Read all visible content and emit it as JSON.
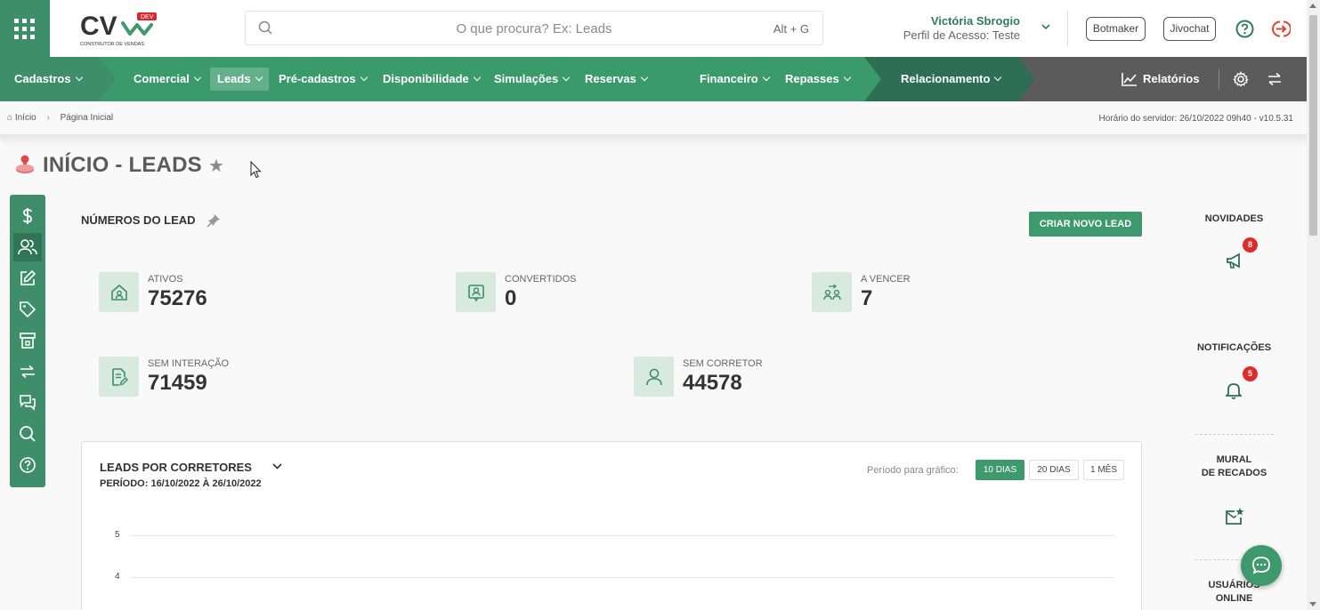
{
  "header": {
    "logo_main": "CV",
    "logo_badge": "DEV",
    "logo_sub": "CONSTRUTOR DE VENDAS",
    "search_placeholder": "O que procura? Ex: Leads",
    "search_shortcut": "Alt + G",
    "user_name": "Victória Sbrogio",
    "user_profile": "Perfil de Acesso: Teste",
    "btn_botmaker": "Botmaker",
    "btn_jivochat": "Jivochat"
  },
  "nav": {
    "items": [
      {
        "label": "Cadastros"
      },
      {
        "label": "Comercial"
      },
      {
        "label": "Leads"
      },
      {
        "label": "Pré-cadastros"
      },
      {
        "label": "Disponibilidade"
      },
      {
        "label": "Simulações"
      },
      {
        "label": "Reservas"
      },
      {
        "label": "Financeiro"
      },
      {
        "label": "Repasses"
      },
      {
        "label": "Relacionamento"
      }
    ],
    "reports": "Relatórios",
    "colors": {
      "primary": "#3e8e6a",
      "dark": "#2e6e55",
      "gray": "#5b5b5b"
    }
  },
  "breadcrumb": {
    "home": "Início",
    "current": "Página Inicial",
    "server_time": "Horário do servidor: 26/10/2022 09h40 - v10.5.31"
  },
  "page": {
    "title": "INÍCIO - LEADS"
  },
  "rail_icons": [
    "dollar-icon",
    "users-icon",
    "edit-icon",
    "tag-icon",
    "building-icon",
    "transfer-icon",
    "chat-icon",
    "search-icon",
    "help-icon"
  ],
  "numbers": {
    "title": "NÚMEROS DO LEAD",
    "new_lead_button": "CRIAR NOVO LEAD",
    "stats": [
      {
        "label": "ATIVOS",
        "value": "75276",
        "icon": "house-user-icon"
      },
      {
        "label": "CONVERTIDOS",
        "value": "0",
        "icon": "user-badge-icon"
      },
      {
        "label": "A VENCER",
        "value": "7",
        "icon": "users-swap-icon"
      },
      {
        "label": "SEM INTERAÇÃO",
        "value": "71459",
        "icon": "document-edit-icon"
      },
      {
        "label": "SEM CORRETOR",
        "value": "44578",
        "icon": "user-icon"
      }
    ]
  },
  "chart_card": {
    "title": "LEADS POR CORRETORES",
    "period": "PERÍODO: 16/10/2022 À 26/10/2022",
    "period_label": "Período para gráfico:",
    "period_options": [
      "10 DIAS",
      "20 DIAS",
      "1 MÊS"
    ],
    "period_selected": "10 DIAS"
  },
  "chart_data": {
    "type": "bar",
    "title": "LEADS POR CORRETORES",
    "y_ticks": [
      "5",
      "4"
    ],
    "ylim": [
      4,
      5
    ],
    "categories": [],
    "values": []
  },
  "right_panel": {
    "news": {
      "label": "NOVIDADES",
      "count": "8"
    },
    "notifications": {
      "label": "NOTIFICAÇÕES",
      "count": "5"
    },
    "board_line1": "MURAL",
    "board_line2": "DE RECADOS",
    "online_line1": "USUÁRIOS",
    "online_line2": "ONLINE"
  }
}
